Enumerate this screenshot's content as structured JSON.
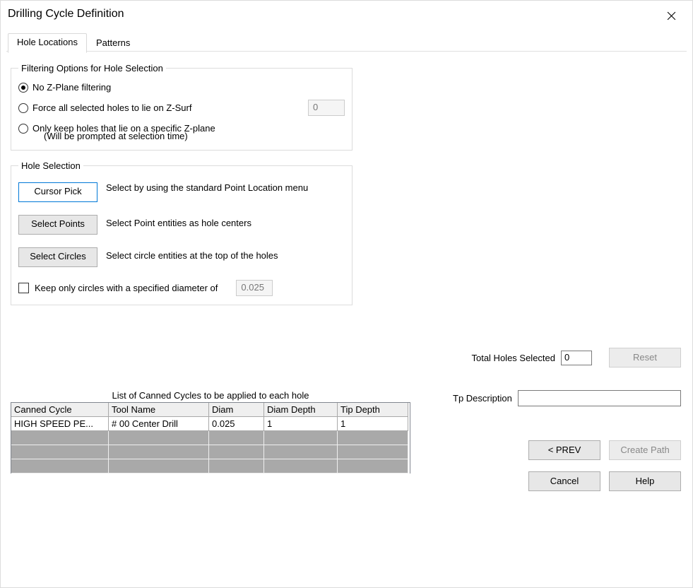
{
  "window": {
    "title": "Drilling Cycle Definition"
  },
  "tabs": {
    "hole_locations": "Hole Locations",
    "patterns": "Patterns"
  },
  "filtering": {
    "legend": "Filtering Options for Hole Selection",
    "opt_no_filter": "No Z-Plane filtering",
    "opt_force": "Force all selected holes to lie on Z-Surf",
    "opt_force_value": "0",
    "opt_keep": "Only keep holes that lie on a specific Z-plane",
    "opt_keep_sub": "(Will be prompted at selection time)"
  },
  "selection": {
    "legend": "Hole Selection",
    "cursor_pick_btn": "Cursor Pick",
    "cursor_pick_desc": "Select by using the standard Point Location menu",
    "select_points_btn": "Select Points",
    "select_points_desc": "Select Point entities as hole centers",
    "select_circles_btn": "Select Circles",
    "select_circles_desc": "Select circle entities at the top of the holes",
    "keep_only_chk": "Keep only circles with a specified diameter of",
    "keep_only_val": "0.025"
  },
  "totals": {
    "label": "Total Holes Selected",
    "value": "0",
    "reset_btn": "Reset"
  },
  "list": {
    "title": "List of Canned Cycles to be applied to each hole",
    "headers": {
      "c0": "Canned Cycle",
      "c1": "Tool Name",
      "c2": "Diam",
      "c3": "Diam Depth",
      "c4": "Tip Depth"
    },
    "row0": {
      "c0": "HIGH SPEED PE...",
      "c1": "# 00 Center Drill",
      "c2": "0.025",
      "c3": "1",
      "c4": "1"
    }
  },
  "tp": {
    "label": "Tp Description",
    "value": ""
  },
  "buttons": {
    "prev": "< PREV",
    "create": "Create Path",
    "cancel": "Cancel",
    "help": "Help"
  }
}
